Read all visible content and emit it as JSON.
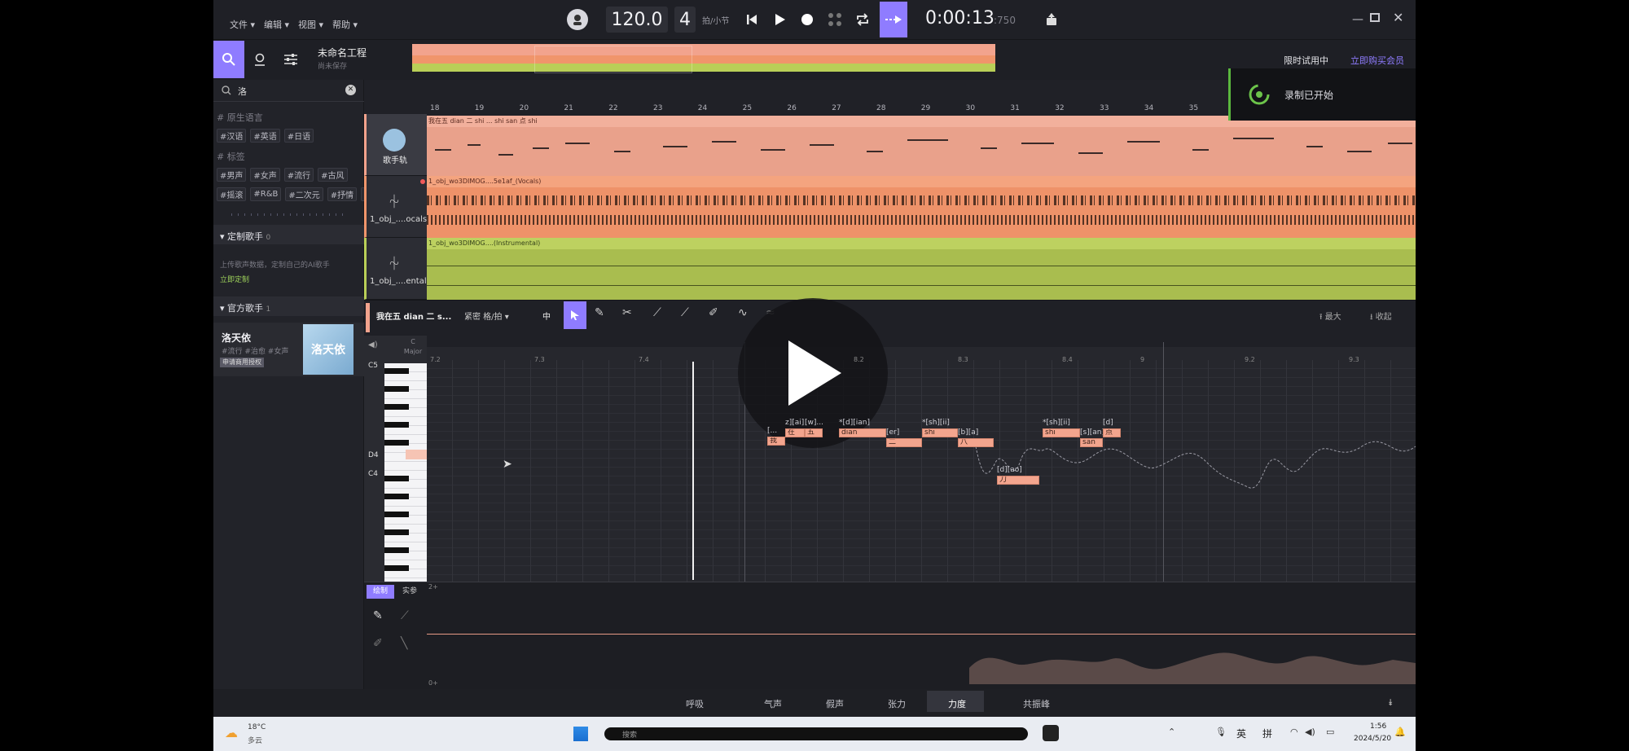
{
  "menu": [
    "文件 ▾",
    "编辑 ▾",
    "视图 ▾",
    "帮助 ▾"
  ],
  "transport": {
    "tempo": "120.0",
    "beats": "4",
    "beats_unit": "拍/小节",
    "time": "0:00:13",
    "time_frac": ":750"
  },
  "project": {
    "name": "未命名工程",
    "status": "尚未保存"
  },
  "trial": {
    "label": "限时试用中",
    "buy": "立即购买会员"
  },
  "toast": {
    "text": "录制已开始"
  },
  "search": {
    "value": "洛"
  },
  "left": {
    "native_lang_label": "# 原生语言",
    "langs": [
      "#汉语",
      "#英语",
      "#日语"
    ],
    "tags_label": "# 标签",
    "tags_row1": [
      "#男声",
      "#女声",
      "#流行",
      "#古风"
    ],
    "tags_row2": [
      "#摇滚",
      "#R&B",
      "#二次元",
      "#抒情"
    ],
    "custom_title": "定制歌手",
    "custom_count": "0",
    "custom_desc": "上传歌声数据，定制自己的AI歌手",
    "custom_link": "立即定制",
    "official_title": "官方歌手",
    "official_count": "1",
    "singer_name": "洛天依",
    "singer_tags": "#流行 #治愈 #女声",
    "singer_license": "申请商用授权",
    "singer_card_text": "洛天依"
  },
  "tracks": [
    {
      "name": "歌手轨",
      "clip": "我在五 dian 二 shi ... shi san 点 shi"
    },
    {
      "name": "1_obj_....ocals)",
      "clip": "1_obj_wo3DIMOG....5e1af_(Vocals)"
    },
    {
      "name": "1_obj_....ental)",
      "clip": "1_obj_wo3DIMOG....(Instrumental)"
    }
  ],
  "ruler": [
    "18",
    "19",
    "20",
    "21",
    "22",
    "23",
    "24",
    "25",
    "26",
    "27",
    "28",
    "29",
    "30",
    "31",
    "32",
    "33",
    "34",
    "35"
  ],
  "editor": {
    "clip_title": "我在五 dian 二 s...",
    "snap": "紧密 格/拍 ▾",
    "mode": "中",
    "maximize": "最大",
    "collapse": "收起",
    "key": "C",
    "scale": "Major",
    "marks": [
      "7.2",
      "7.3",
      "7.4",
      "8.2",
      "8.3",
      "8.4",
      "9",
      "9.2",
      "9.3"
    ],
    "keys": [
      "C5",
      "D4",
      "C4"
    ]
  },
  "notes": [
    {
      "ph": "[... ",
      "tx": "我"
    },
    {
      "ph": "z][ai]",
      "tx": "在"
    },
    {
      "ph": "[w]...",
      "tx": "五"
    },
    {
      "ph": "*[d][ian]",
      "tx": "dian"
    },
    {
      "ph": "[er]",
      "tx": "二"
    },
    {
      "ph": "*[sh][ii]",
      "tx": "shi"
    },
    {
      "ph": "[b][a]",
      "tx": "八"
    },
    {
      "ph": "[d][ao]",
      "tx": "刀"
    },
    {
      "ph": "*[sh][ii]",
      "tx": "shi"
    },
    {
      "ph": "[s][an]",
      "tx": "san"
    },
    {
      "ph": "[d]",
      "tx": "点"
    }
  ],
  "param": {
    "tab1": "绘制",
    "tab2": "实参",
    "top": "2+",
    "bottom": "0+"
  },
  "bottom_tabs": [
    "呼吸",
    "气声",
    "假声",
    "张力",
    "力度",
    "共振峰"
  ],
  "taskbar": {
    "temp": "18°C",
    "weather": "多云",
    "search": "搜索",
    "ime1": "英",
    "ime2": "拼",
    "clock": "1:56",
    "date": "2024/5/20"
  },
  "colors": {
    "accent": "#8f7cff",
    "vocal_track": "#f2a38d",
    "audio_track": "#f0956b",
    "instr_track": "#b9cf57"
  }
}
